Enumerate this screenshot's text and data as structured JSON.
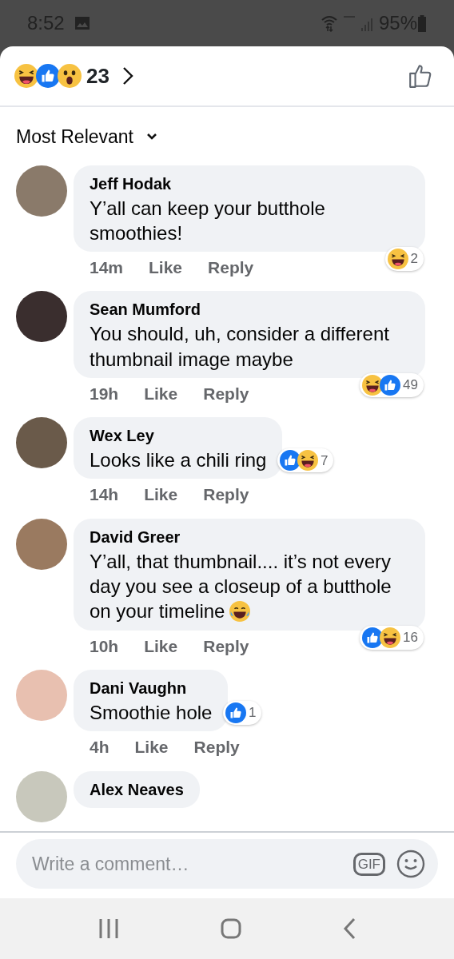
{
  "status_bar": {
    "time": "8:52",
    "battery": "95%"
  },
  "header": {
    "reactions": [
      {
        "kind": "haha"
      },
      {
        "kind": "like"
      },
      {
        "kind": "wow"
      }
    ],
    "count": "23"
  },
  "sort": {
    "label": "Most Relevant"
  },
  "comments": [
    {
      "name": "Jeff Hodak",
      "text": "Y’all can keep your butthole smoothies!",
      "time": "14m",
      "like": "Like",
      "reply": "Reply",
      "reactions": [
        {
          "kind": "haha"
        }
      ],
      "reaction_count": "2"
    },
    {
      "name": "Sean Mumford",
      "text": "You should, uh, consider a different thumbnail image maybe",
      "time": "19h",
      "like": "Like",
      "reply": "Reply",
      "reactions": [
        {
          "kind": "haha"
        },
        {
          "kind": "like"
        }
      ],
      "reaction_count": "49"
    },
    {
      "name": "Wex Ley",
      "text": "Looks like a chili ring",
      "time": "14h",
      "like": "Like",
      "reply": "Reply",
      "reactions": [
        {
          "kind": "like"
        },
        {
          "kind": "haha"
        }
      ],
      "reaction_count": "7"
    },
    {
      "name": "David Greer",
      "text": "Y’all, that thumbnail.... it’s not every day you see a closeup of a butthole on your timeline",
      "trailing_emoji": {
        "kind": "tears"
      },
      "time": "10h",
      "like": "Like",
      "reply": "Reply",
      "reactions": [
        {
          "kind": "like"
        },
        {
          "kind": "haha"
        }
      ],
      "reaction_count": "16"
    },
    {
      "name": "Dani Vaughn",
      "text": "Smoothie hole",
      "time": "4h",
      "like": "Like",
      "reply": "Reply",
      "reactions": [
        {
          "kind": "like"
        }
      ],
      "reaction_count": "1"
    },
    {
      "name": "Alex Neaves"
    }
  ],
  "composer": {
    "placeholder": "Write a comment…",
    "gif_label": "GIF"
  }
}
